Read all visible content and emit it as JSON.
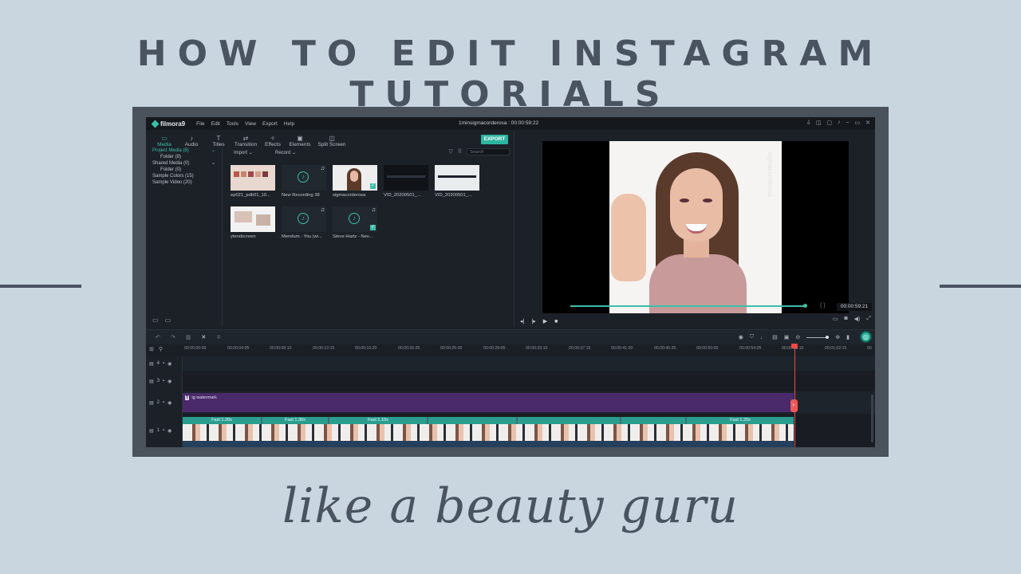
{
  "headline": "HOW TO EDIT INSTAGRAM TUTORIALS",
  "tagline": "like a beauty guru",
  "app": {
    "logo": "filmora9",
    "menu": [
      "File",
      "Edit",
      "Tools",
      "View",
      "Export",
      "Help"
    ],
    "project_title": "1minsigmacorderosa : 00:00:59:22",
    "toolbar": [
      "Media",
      "Audio",
      "Titles",
      "Transition",
      "Effects",
      "Elements",
      "Split Screen"
    ],
    "export_label": "EXPORT",
    "library": [
      {
        "label": "Project Media (8)",
        "indent": false,
        "active": true
      },
      {
        "label": "Folder (8)",
        "indent": true,
        "active": false
      },
      {
        "label": "Shared Media (0)",
        "indent": false,
        "active": false
      },
      {
        "label": "Folder (0)",
        "indent": true,
        "active": false
      },
      {
        "label": "Sample Colors (15)",
        "indent": false,
        "active": false
      },
      {
        "label": "Sample Video (20)",
        "indent": false,
        "active": false
      }
    ],
    "import_label": "Import",
    "record_label": "Record",
    "search_placeholder": "Search",
    "media_tiles": [
      {
        "label": "ep021_pdb01_10...",
        "kind": "palette"
      },
      {
        "label": "New Recording 38",
        "kind": "music"
      },
      {
        "label": "sigmacorderosa",
        "kind": "portrait"
      },
      {
        "label": "VID_20200501_...",
        "kind": "dark"
      },
      {
        "label": "VID_20200501_...",
        "kind": "dark"
      },
      {
        "label": "ytendscreen",
        "kind": "endscreen"
      },
      {
        "label": "Mendum - You |wi...",
        "kind": "music"
      },
      {
        "label": "Steve Hartz - Nev...",
        "kind": "music"
      }
    ],
    "preview_time": "00:00:59:21",
    "preview_watermark": "sigmacorderosa",
    "ruler_ticks": [
      "00:00:00:00",
      "00:00:04:05",
      "00:00:08:10",
      "00:00:12:15",
      "00:00:16:20",
      "00:00:20:25",
      "00:00:25:00",
      "00:00:29:05",
      "00:00:33:10",
      "00:00:37:15",
      "00:00:41:20",
      "00:00:45:25",
      "00:00:50:00",
      "00:00:54:05",
      "00:00:58:10",
      "00:01:02:15",
      "00"
    ],
    "tracks": [
      {
        "num": "4",
        "label": ""
      },
      {
        "num": "3",
        "label": ""
      },
      {
        "num": "2",
        "label": "ig watermark"
      },
      {
        "num": "1",
        "label": ""
      }
    ],
    "speed_labels": [
      "Fast 1.20x",
      "Fast 1.30x",
      "Fast 1.10x",
      "Fast 1.20x"
    ]
  }
}
